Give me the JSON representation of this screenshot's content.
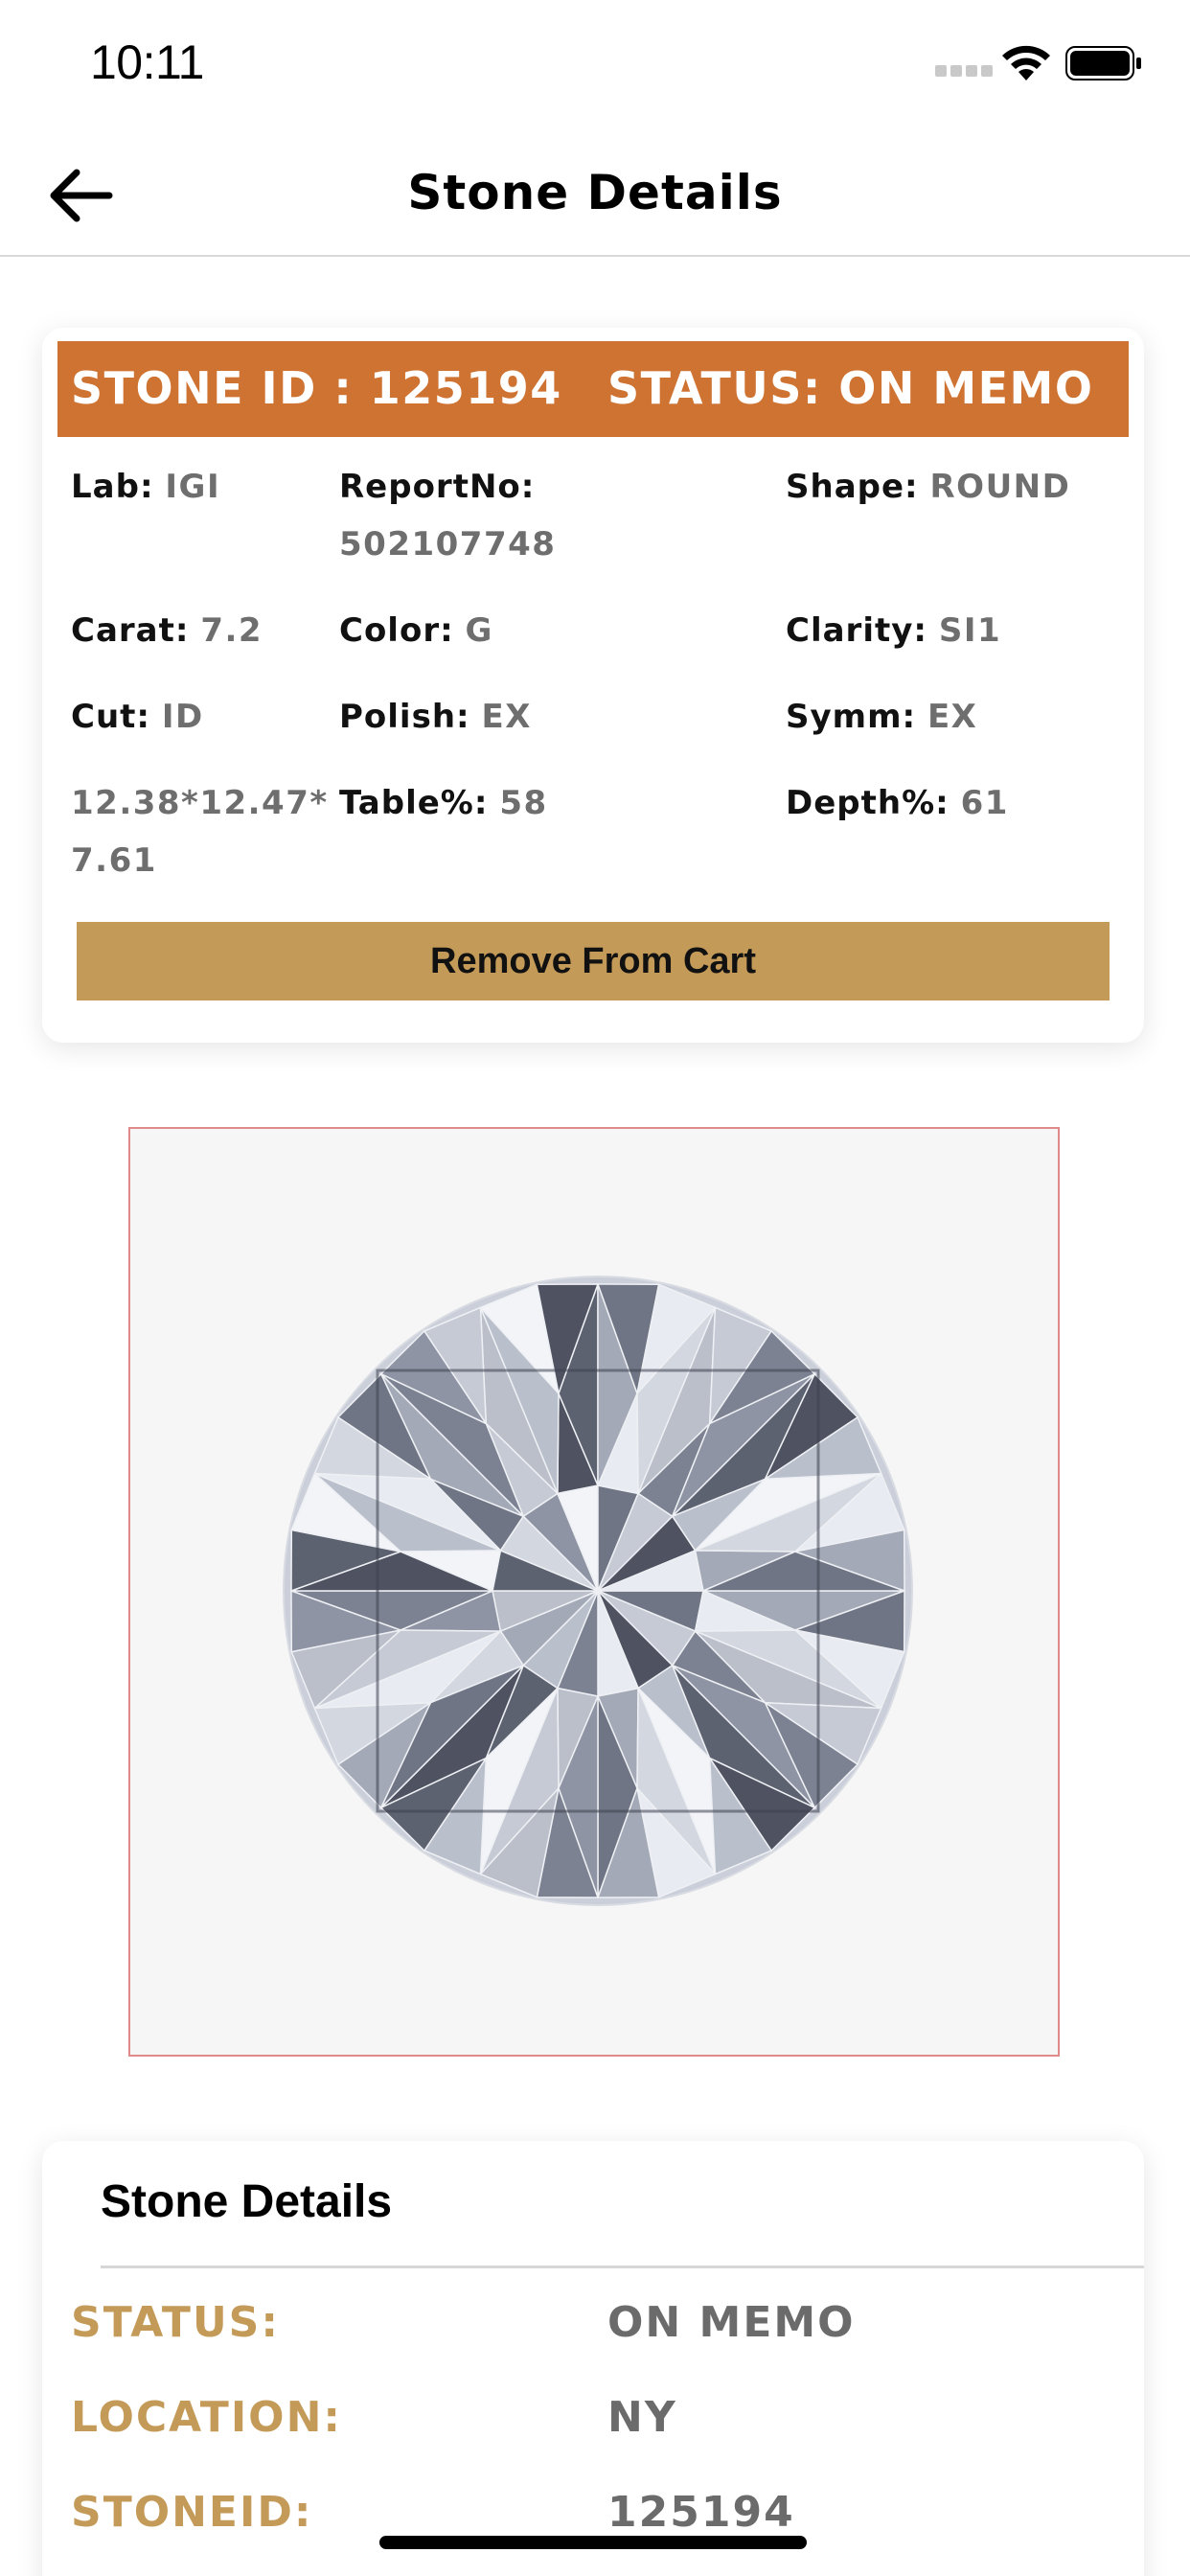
{
  "status_bar": {
    "time": "10:11"
  },
  "nav": {
    "title": "Stone Details"
  },
  "summary": {
    "stone_id": "STONE ID : 125194",
    "status": "STATUS: ON MEMO",
    "lab_label": "Lab:",
    "lab_value": "IGI",
    "report_label": "ReportNo:",
    "report_value": "502107748",
    "shape_label": "Shape:",
    "shape_value": "ROUND",
    "carat_label": "Carat:",
    "carat_value": "7.2",
    "color_label": "Color:",
    "color_value": "G",
    "clarity_label": "Clarity:",
    "clarity_value": "SI1",
    "cut_label": "Cut:",
    "cut_value": "ID",
    "polish_label": "Polish:",
    "polish_value": "EX",
    "symm_label": "Symm:",
    "symm_value": "EX",
    "measure_line1": "12.38*12.47*",
    "measure_line2": "7.61",
    "table_label": "Table%:",
    "table_value": "58",
    "depth_label": "Depth%:",
    "depth_value": "61",
    "remove_button": "Remove From Cart"
  },
  "details": {
    "title": "Stone Details",
    "rows": [
      {
        "label": "STATUS:",
        "value": "ON MEMO"
      },
      {
        "label": "LOCATION:",
        "value": "NY"
      },
      {
        "label": "STONEID:",
        "value": "125194"
      }
    ]
  },
  "colors": {
    "banner": "#cf7332",
    "button": "#c49a58",
    "detail_label": "#c49a58",
    "value_gray": "#6e6e6e",
    "image_border": "#e08a8a"
  },
  "icons": [
    "back-arrow-icon",
    "signal-icon",
    "wifi-icon",
    "battery-icon"
  ]
}
